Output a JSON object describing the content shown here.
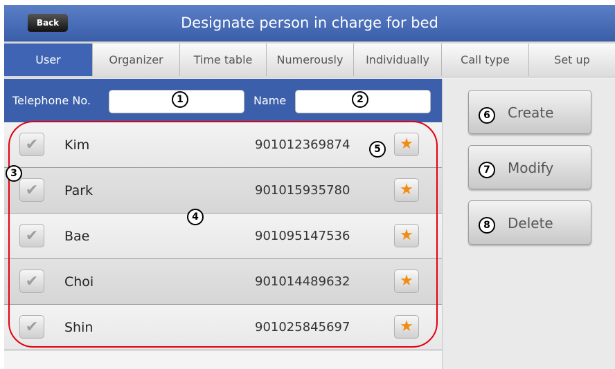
{
  "header": {
    "back_label": "Back",
    "title": "Designate person in charge for bed"
  },
  "tabs": [
    {
      "label": "User",
      "active": true
    },
    {
      "label": "Organizer"
    },
    {
      "label": "Time table"
    },
    {
      "label": "Numerously"
    },
    {
      "label": "Individually"
    },
    {
      "label": "Call type"
    },
    {
      "label": "Set up"
    }
  ],
  "search": {
    "phone_label": "Telephone No.",
    "phone_value": "",
    "name_label": "Name",
    "name_value": ""
  },
  "users": [
    {
      "name": "Kim",
      "phone": "901012369874"
    },
    {
      "name": "Park",
      "phone": "901015935780"
    },
    {
      "name": "Bae",
      "phone": "901095147536"
    },
    {
      "name": "Choi",
      "phone": "901014489632"
    },
    {
      "name": "Shin",
      "phone": "901025845697"
    }
  ],
  "actions": {
    "create_label": "Create",
    "modify_label": "Modify",
    "delete_label": "Delete"
  },
  "annotations": [
    "1",
    "2",
    "3",
    "4",
    "5",
    "6",
    "7",
    "8"
  ],
  "colors": {
    "header": "#3b5ea9",
    "active_tab": "#3f64b3",
    "search_bar": "#3b5fab",
    "star": "#f28c10",
    "outline": "#e3000f"
  },
  "icons": {
    "check": "checkmark-icon",
    "star": "star-icon",
    "back": "back-arrow-icon"
  }
}
